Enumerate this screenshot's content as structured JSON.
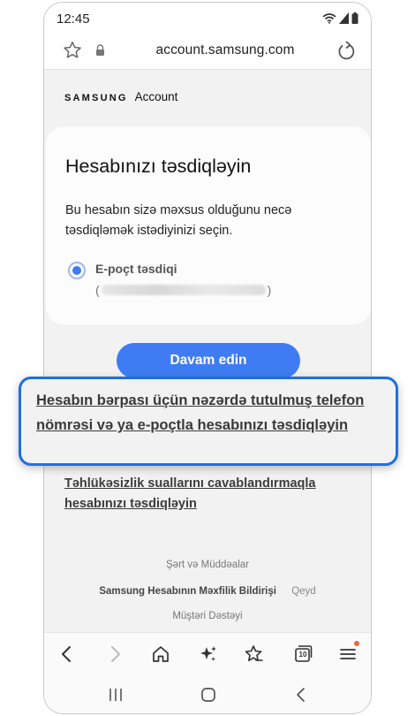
{
  "status_bar": {
    "time": "12:45"
  },
  "browser": {
    "url": "account.samsung.com"
  },
  "brand": {
    "name": "SAMSUNG",
    "product": "Account"
  },
  "card": {
    "title": "Hesabınızı təsdiqləyin",
    "description": "Bu hesabın sizə məxsus olduğunu necə təsdiqləmək istədiyinizi seçin.",
    "option_label": "E-poçt təsdiqi",
    "email_open_paren": "(",
    "email_close_paren": ")"
  },
  "continue_button": "Davam edin",
  "links": {
    "recovery": "Hesabın bərpası üçün nəzərdə tutulmuş telefon nömrəsi və ya e-poçtla hesabınızı təsdiqləyin",
    "security_questions": "Təhlükəsizlik suallarını cavablandırmaqla hesabınızı təsdiqləyin"
  },
  "footer": {
    "terms": "Şərt və Müddəalar",
    "privacy": "Samsung Hesabının Məxfilik Bildirişi",
    "notes": "Qeyd",
    "support": "Müştəri Dəstəyi"
  },
  "toolbar": {
    "tabs_count": "10"
  },
  "colors": {
    "accent": "#3f7cf4",
    "highlight_border": "#1f6fe0",
    "notification_dot": "#e8663d"
  }
}
